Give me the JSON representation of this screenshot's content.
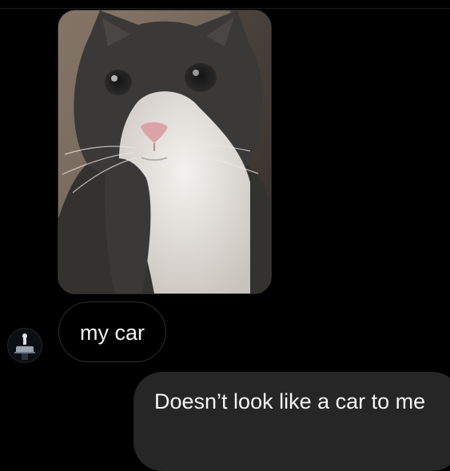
{
  "conversation": {
    "messages": [
      {
        "direction": "incoming",
        "kind": "photo",
        "photo_subject": "cat-photo",
        "sender_avatar": "sender-avatar-photo"
      },
      {
        "direction": "incoming",
        "kind": "text",
        "text": "my car"
      },
      {
        "direction": "outgoing",
        "kind": "text",
        "text": "Doesn’t look like a car to me"
      }
    ]
  },
  "colors": {
    "background": "#000000",
    "incoming_bubble_border": "#2e2e2e",
    "outgoing_bubble": "#262626",
    "text": "#f2f2f2"
  }
}
